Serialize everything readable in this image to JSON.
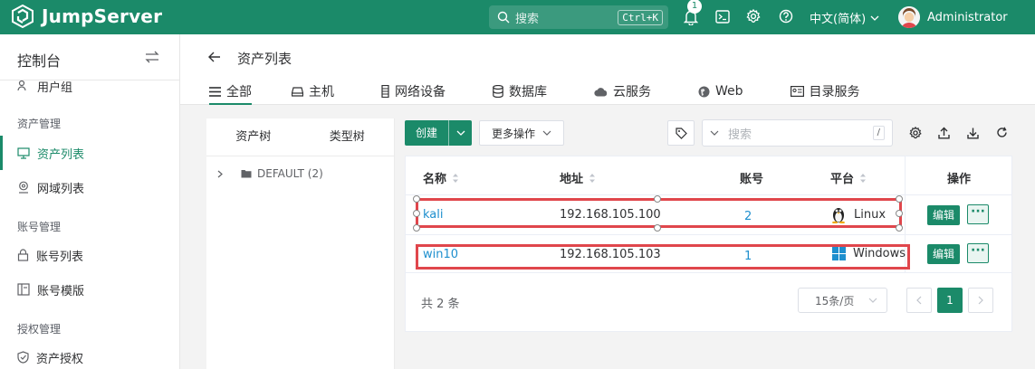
{
  "header": {
    "brand": "JumpServer",
    "search_placeholder": "搜索",
    "search_shortcut": "Ctrl+K",
    "notification_count": "1",
    "language": "中文(简体)",
    "user_name": "Administrator"
  },
  "sidebar": {
    "title": "控制台",
    "items": [
      {
        "label": "用户组"
      },
      {
        "label": "资产列表"
      },
      {
        "label": "网域列表"
      },
      {
        "label": "账号列表"
      },
      {
        "label": "账号模版"
      },
      {
        "label": "资产授权"
      }
    ],
    "groups": [
      "资产管理",
      "账号管理",
      "授权管理"
    ]
  },
  "page": {
    "title": "资产列表",
    "tabs": [
      {
        "label": "全部",
        "icon": "list-icon"
      },
      {
        "label": "主机",
        "icon": "host-icon"
      },
      {
        "label": "网络设备",
        "icon": "network-device-icon"
      },
      {
        "label": "数据库",
        "icon": "database-icon"
      },
      {
        "label": "云服务",
        "icon": "cloud-icon"
      },
      {
        "label": "Web",
        "icon": "globe-icon"
      },
      {
        "label": "目录服务",
        "icon": "directory-icon"
      }
    ]
  },
  "tree": {
    "tabs": [
      "资产树",
      "类型树"
    ],
    "root": "DEFAULT (2)"
  },
  "toolbar": {
    "create": "创建",
    "more_actions": "更多操作",
    "search_placeholder": "搜索",
    "search_shortcut": "/"
  },
  "table": {
    "columns": [
      "名称",
      "地址",
      "账号",
      "平台",
      "操作"
    ],
    "rows": [
      {
        "name": "kali",
        "address": "192.168.105.100",
        "accounts": "2",
        "platform": "Linux",
        "edit": "编辑",
        "more": "···"
      },
      {
        "name": "win10",
        "address": "192.168.105.103",
        "accounts": "1",
        "platform": "Windows",
        "edit": "编辑",
        "more": "···"
      }
    ],
    "total": "共 2 条",
    "page_size": "15条/页",
    "current_page": "1"
  },
  "colors": {
    "brand": "#1b8a69",
    "link": "#1e8fce",
    "highlight": "#e0464c"
  }
}
